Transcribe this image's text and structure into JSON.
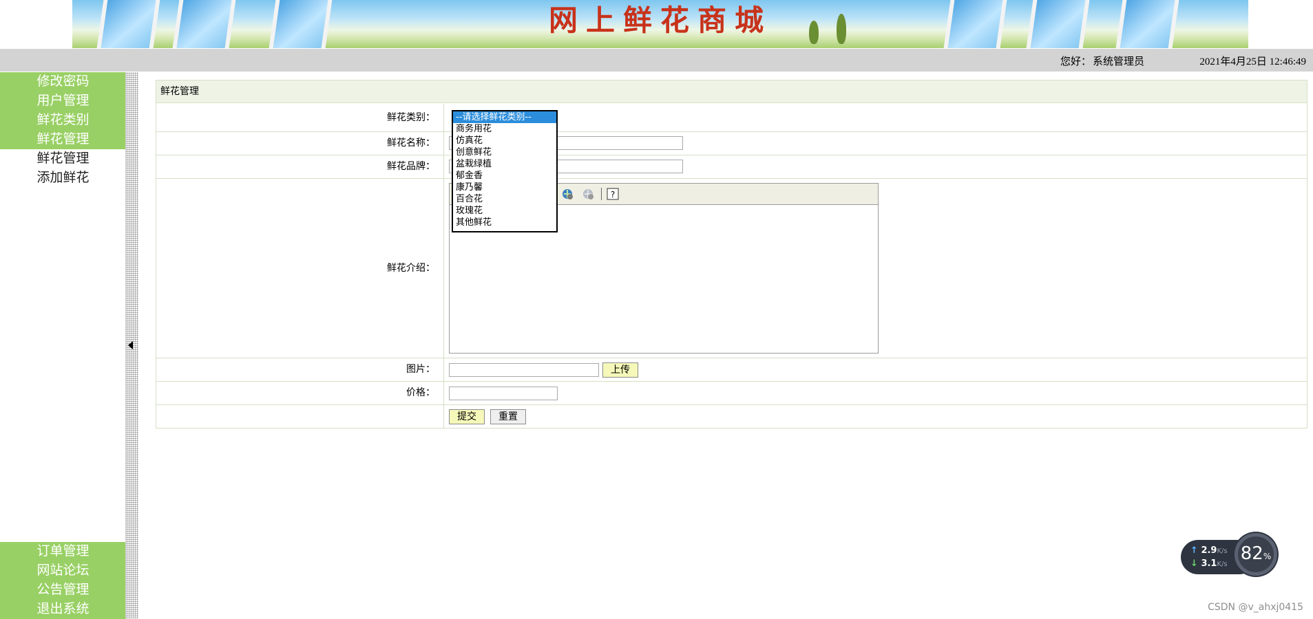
{
  "banner": {
    "title": "网上鲜花商城"
  },
  "info_bar": {
    "greeting": "您好：",
    "user": "系统管理员",
    "datetime": "2021年4月25日 12:46:49"
  },
  "sidebar": {
    "top_items": [
      "修改密码",
      "用户管理",
      "鲜花类别",
      "鲜花管理"
    ],
    "sub_items": [
      "鲜花管理",
      "添加鲜花"
    ],
    "bottom_items": [
      "订单管理",
      "网站论坛",
      "公告管理",
      "退出系统"
    ]
  },
  "form": {
    "header": "鲜花管理",
    "category_label": "鲜花类别：",
    "name_label": "鲜花名称：",
    "brand_label": "鲜花品牌：",
    "description_label": "鲜花介绍：",
    "image_label": "图片：",
    "price_label": "价格：",
    "upload_button": "上传",
    "submit_button": "提交",
    "reset_button": "重置"
  },
  "category_dropdown": {
    "selected_index": 0,
    "options": [
      "--请选择鲜花类别--",
      "商务用花",
      "仿真花",
      "创意鲜花",
      "盆栽绿植",
      "郁金香",
      "康乃馨",
      "百合花",
      "玫瑰花",
      "其他鲜花"
    ]
  },
  "editor": {
    "toolbar_icons": [
      "insert-link-icon",
      "remove-link-icon",
      "help-icon"
    ]
  },
  "network_widget": {
    "upload": "2.9",
    "upload_unit": "K/s",
    "download": "3.1",
    "download_unit": "K/s",
    "cpu": "82",
    "cpu_unit": "%"
  },
  "watermark": "CSDN @v_ahxj0415"
}
